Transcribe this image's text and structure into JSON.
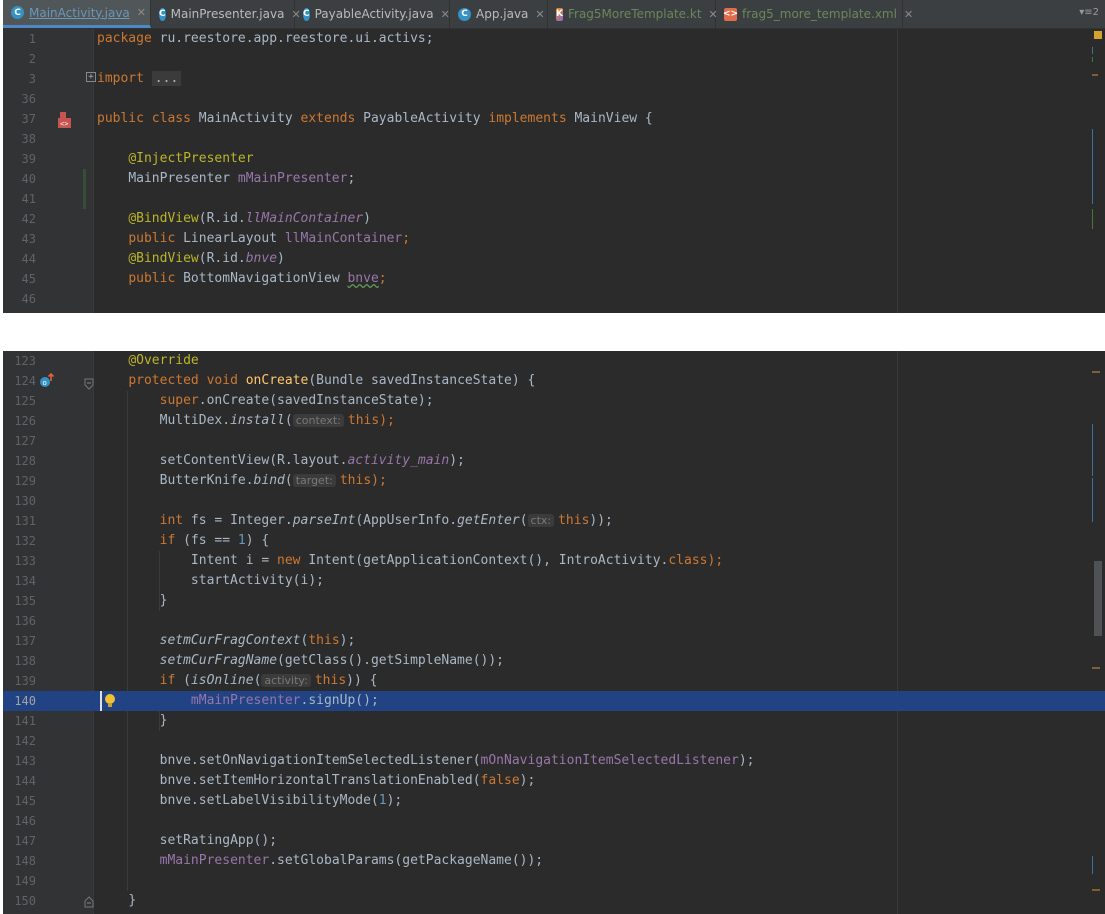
{
  "tabs": [
    {
      "label": "MainActivity.java",
      "icon": "class-icon",
      "active": true,
      "modified": true
    },
    {
      "label": "MainPresenter.java",
      "icon": "class-icon"
    },
    {
      "label": "PayableActivity.java",
      "icon": "class-icon"
    },
    {
      "label": "App.java",
      "icon": "class-icon"
    },
    {
      "label": "Frag5MoreTemplate.kt",
      "icon": "kotlin-file-icon"
    },
    {
      "label": "frag5_more_template.xml",
      "icon": "xml-file-icon"
    }
  ],
  "tab_overflow_count": "2",
  "top_editor": {
    "lines": [
      {
        "n": "1"
      },
      {
        "n": "2"
      },
      {
        "n": "3"
      },
      {
        "n": "36"
      },
      {
        "n": "37"
      },
      {
        "n": "38"
      },
      {
        "n": "39"
      },
      {
        "n": "40"
      },
      {
        "n": "41"
      },
      {
        "n": "42"
      },
      {
        "n": "43"
      },
      {
        "n": "44"
      },
      {
        "n": "45"
      },
      {
        "n": "46"
      }
    ],
    "text": {
      "package_kw": "package",
      "package_name": "ru.reestore.app.reestore.ui.activs;",
      "import_kw": "import",
      "import_fold": "...",
      "l37_public": "public",
      "l37_class": "class",
      "l37_name": " MainActivity ",
      "l37_extends": "extends",
      "l37_parent": " PayableActivity ",
      "l37_implements": "implements",
      "l37_iface": " MainView {",
      "l39_ann": "@InjectPresenter",
      "l40_type": "MainPresenter ",
      "l40_field": "mMainPresenter",
      "l40_semi": ";",
      "l42_ann": "@BindView",
      "l42_a": "(R.id.",
      "l42_id": "llMainContainer",
      "l42_b": ")",
      "l43_public": "public",
      "l43_type": " LinearLayout ",
      "l43_field": "llMainContainer",
      "l43_semi": ";",
      "l44_ann": "@BindView",
      "l44_a": "(R.id.",
      "l44_id": "bnve",
      "l44_b": ")",
      "l45_public": "public",
      "l45_type": " BottomNavigationView ",
      "l45_field": "bnve",
      "l45_semi": ";"
    }
  },
  "bottom_editor": {
    "lines": [
      {
        "n": "123"
      },
      {
        "n": "124"
      },
      {
        "n": "125"
      },
      {
        "n": "126"
      },
      {
        "n": "127"
      },
      {
        "n": "128"
      },
      {
        "n": "129"
      },
      {
        "n": "130"
      },
      {
        "n": "131"
      },
      {
        "n": "132"
      },
      {
        "n": "133"
      },
      {
        "n": "134"
      },
      {
        "n": "135"
      },
      {
        "n": "136"
      },
      {
        "n": "137"
      },
      {
        "n": "138"
      },
      {
        "n": "139"
      },
      {
        "n": "140"
      },
      {
        "n": "141"
      },
      {
        "n": "142"
      },
      {
        "n": "143"
      },
      {
        "n": "144"
      },
      {
        "n": "145"
      },
      {
        "n": "146"
      },
      {
        "n": "147"
      },
      {
        "n": "148"
      },
      {
        "n": "149"
      },
      {
        "n": "150"
      }
    ],
    "highlighted_line": "140",
    "text": {
      "l123": "@Override",
      "l124_kw1": "protected",
      "l124_kw2": " void ",
      "l124_fn": "onCreate",
      "l124_rest": "(Bundle savedInstanceState) {",
      "l125_kw": "super",
      "l125_rest": ".onCreate(savedInstanceState);",
      "l126_a": "MultiDex.",
      "l126_m": "install",
      "l126_b": "(",
      "l126_hint": "context:",
      "l126_kw": "this",
      "l126_c": ");",
      "l128_a": "setContentView(R.layout.",
      "l128_f": "activity_main",
      "l128_b": ");",
      "l129_a": "ButterKnife.",
      "l129_m": "bind",
      "l129_b": "(",
      "l129_hint": "target:",
      "l129_kw": "this",
      "l129_c": ");",
      "l131_kw": "int",
      "l131_a": " fs = Integer.",
      "l131_m": "parseInt",
      "l131_b": "(AppUserInfo.",
      "l131_m2": "getEnter",
      "l131_c": "(",
      "l131_hint": "ctx:",
      "l131_kw2": "this",
      "l131_d": "));",
      "l132_kw": "if",
      "l132_a": " (fs == ",
      "l132_n": "1",
      "l132_b": ") {",
      "l133_a": "Intent i = ",
      "l133_kw": "new",
      "l133_b": " Intent(getApplicationContext(), IntroActivity.",
      "l133_kw2": "class",
      "l133_c": ");",
      "l134": "startActivity(i);",
      "l135": "}",
      "l137_m": "setmCurFragContext",
      "l137_a": "(",
      "l137_kw": "this",
      "l137_b": ");",
      "l138_m": "setmCurFragName",
      "l138_a": "(getClass().getSimpleName());",
      "l139_kw": "if",
      "l139_a": " (",
      "l139_m": "isOnline",
      "l139_b": "(",
      "l139_hint": "activity:",
      "l139_kw2": "this",
      "l139_c": ")) {",
      "l140_f": "mMainPresenter",
      "l140_a": ".signUp();",
      "l141": "}",
      "l143_a": "bnve.setOnNavigationItemSelectedListener(",
      "l143_f": "mOnNavigationItemSelectedListener",
      "l143_b": ");",
      "l144_a": "bnve.setItemHorizontalTranslationEnabled(",
      "l144_kw": "false",
      "l144_b": ");",
      "l145_a": "bnve.setLabelVisibilityMode(",
      "l145_n": "1",
      "l145_b": ");",
      "l147": "setRatingApp();",
      "l148_f": "mMainPresenter",
      "l148_a": ".setGlobalParams(getPackageName());",
      "l150": "}"
    }
  },
  "colors": {
    "background": "#2b2b2b",
    "gutter": "#313335",
    "keyword": "#cc7832",
    "annotation": "#bbb529",
    "field": "#9876aa",
    "number": "#6897bb",
    "method_decl": "#ffc66d",
    "default_text": "#a9b7c6",
    "selection": "#214283",
    "tabbar": "#3c3f41"
  }
}
